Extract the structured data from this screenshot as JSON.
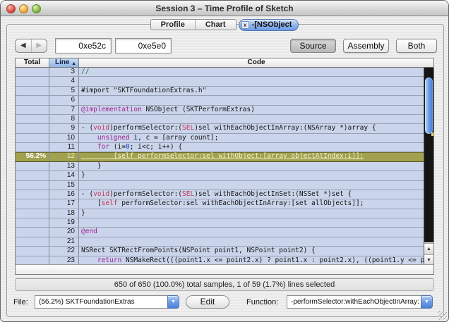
{
  "window": {
    "title": "Session 3 – Time Profile of Sketch"
  },
  "tabs": [
    {
      "label": "Profile",
      "selected": false
    },
    {
      "label": "Chart",
      "selected": false
    },
    {
      "label": "-[NSObject",
      "selected": true,
      "close_label": "x"
    }
  ],
  "toolbar": {
    "back_icon": "◀",
    "forward_icon": "▶",
    "address1": "0xe52c",
    "address2": "0xe5e0",
    "source_label": "Source",
    "assembly_label": "Assembly",
    "both_label": "Both",
    "selected_view": "Source"
  },
  "table": {
    "headers": {
      "total": "Total",
      "line": "Line",
      "code": "Code"
    },
    "sort_icon": "▲",
    "scroll_up_icon": "▲",
    "scroll_down_icon": "▼"
  },
  "rows": [
    {
      "line": "3",
      "total": "",
      "selected": false,
      "code": [
        {
          "t": "//",
          "c": "comment"
        }
      ]
    },
    {
      "line": "4",
      "total": "",
      "selected": false,
      "code": []
    },
    {
      "line": "5",
      "total": "",
      "selected": false,
      "code": [
        {
          "t": "#import \"SKTFoundationExtras.h\"",
          "c": ""
        }
      ]
    },
    {
      "line": "6",
      "total": "",
      "selected": false,
      "code": []
    },
    {
      "line": "7",
      "total": "",
      "selected": false,
      "code": [
        {
          "t": "@implementation",
          "c": "kw"
        },
        {
          "t": " NSObject (SKTPerformExtras)",
          "c": ""
        }
      ]
    },
    {
      "line": "8",
      "total": "",
      "selected": false,
      "code": []
    },
    {
      "line": "9",
      "total": "",
      "selected": false,
      "code": [
        {
          "t": "- (",
          "c": ""
        },
        {
          "t": "void",
          "c": "type"
        },
        {
          "t": ")performSelector:(",
          "c": ""
        },
        {
          "t": "SEL",
          "c": "type"
        },
        {
          "t": ")sel withEachObjectInArray:(NSArray *)array {",
          "c": ""
        }
      ]
    },
    {
      "line": "10",
      "total": "",
      "selected": false,
      "code": [
        {
          "t": "    ",
          "c": ""
        },
        {
          "t": "unsigned",
          "c": "kw"
        },
        {
          "t": " i, c = [array count];",
          "c": ""
        }
      ]
    },
    {
      "line": "11",
      "total": "",
      "selected": false,
      "code": [
        {
          "t": "    ",
          "c": ""
        },
        {
          "t": "for",
          "c": "kw"
        },
        {
          "t": " (i=",
          "c": ""
        },
        {
          "t": "0",
          "c": "num"
        },
        {
          "t": "; i<c; i++) {",
          "c": ""
        }
      ]
    },
    {
      "line": "12",
      "total": "56.2%",
      "selected": true,
      "code": [
        {
          "t": "        [self performSelector:sel withObject:[array objectAtIndex:i]];",
          "c": ""
        }
      ]
    },
    {
      "line": "13",
      "total": "",
      "selected": false,
      "code": [
        {
          "t": "    }",
          "c": ""
        }
      ]
    },
    {
      "line": "14",
      "total": "",
      "selected": false,
      "code": [
        {
          "t": "}",
          "c": ""
        }
      ]
    },
    {
      "line": "15",
      "total": "",
      "selected": false,
      "code": []
    },
    {
      "line": "16",
      "total": "",
      "selected": false,
      "code": [
        {
          "t": "- (",
          "c": ""
        },
        {
          "t": "void",
          "c": "type"
        },
        {
          "t": ")performSelector:(",
          "c": ""
        },
        {
          "t": "SEL",
          "c": "type"
        },
        {
          "t": ")sel withEachObjectInSet:(NSSet *)set {",
          "c": ""
        }
      ]
    },
    {
      "line": "17",
      "total": "",
      "selected": false,
      "code": [
        {
          "t": "    [",
          "c": ""
        },
        {
          "t": "self",
          "c": "type"
        },
        {
          "t": " performSelector:sel withEachObjectInArray:[set allObjects]];",
          "c": ""
        }
      ]
    },
    {
      "line": "18",
      "total": "",
      "selected": false,
      "code": [
        {
          "t": "}",
          "c": ""
        }
      ]
    },
    {
      "line": "19",
      "total": "",
      "selected": false,
      "code": []
    },
    {
      "line": "20",
      "total": "",
      "selected": false,
      "code": [
        {
          "t": "@end",
          "c": "kw"
        }
      ]
    },
    {
      "line": "21",
      "total": "",
      "selected": false,
      "code": []
    },
    {
      "line": "22",
      "total": "",
      "selected": false,
      "code": [
        {
          "t": "NSRect SKTRectFromPoints(NSPoint point1, NSPoint point2) {",
          "c": ""
        }
      ]
    },
    {
      "line": "23",
      "total": "",
      "selected": false,
      "code": [
        {
          "t": "    ",
          "c": ""
        },
        {
          "t": "return",
          "c": "kw"
        },
        {
          "t": " NSMakeRect(((point1.x <= point2.x) ? point1.x : point2.x), ((point1.y <= p…",
          "c": ""
        }
      ]
    }
  ],
  "status": {
    "text": "650 of 650 (100.0%) total samples, 1 of 59 (1.7%) lines selected"
  },
  "footer": {
    "file_label": "File:",
    "file_value": "(56.2%) SKTFoundationExtras",
    "edit_label": "Edit",
    "function_label": "Function:",
    "function_value": "-performSelector:withEachObjectInArray:",
    "popup_icon": "▼"
  },
  "colors": {
    "selection_olive": "#a1a150",
    "row_tint": "#cad4ea",
    "aqua_accent": "#6f9ee8"
  }
}
